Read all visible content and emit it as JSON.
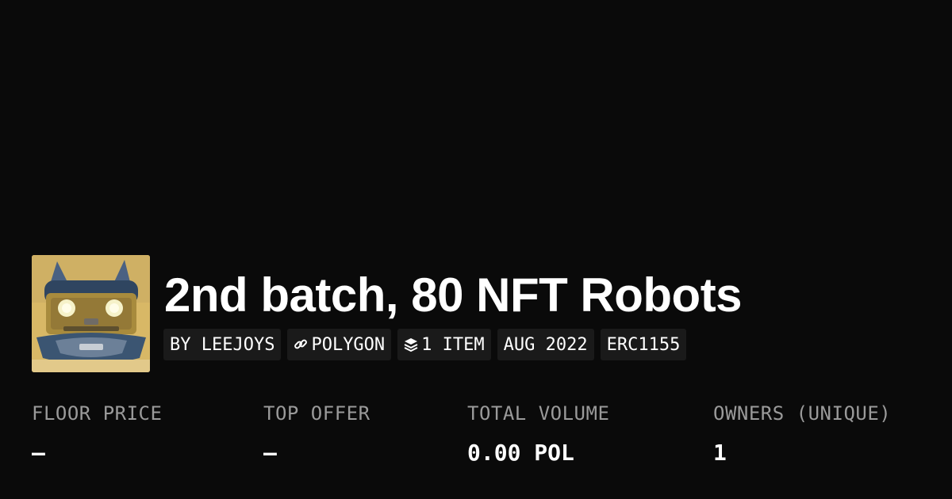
{
  "collection": {
    "title": "2nd batch, 80 NFT Robots",
    "avatar_alt": "robot-face-avatar"
  },
  "badges": [
    {
      "label": "BY LEEJOYS",
      "icon": ""
    },
    {
      "label": "POLYGON",
      "icon": "link-chain-icon"
    },
    {
      "label": "1 ITEM",
      "icon": "layers-stack-icon"
    },
    {
      "label": "AUG 2022",
      "icon": ""
    },
    {
      "label": "ERC1155",
      "icon": ""
    }
  ],
  "stats": [
    {
      "label": "FLOOR PRICE",
      "value": "—"
    },
    {
      "label": "TOP OFFER",
      "value": "—"
    },
    {
      "label": "TOTAL VOLUME",
      "value": "0.00 POL"
    },
    {
      "label": "OWNERS (UNIQUE)",
      "value": "1"
    }
  ],
  "colors": {
    "background": "#0a0a0a",
    "badge_bg": "#1a1a1a",
    "label": "#9a9a9a",
    "text": "#ffffff"
  }
}
